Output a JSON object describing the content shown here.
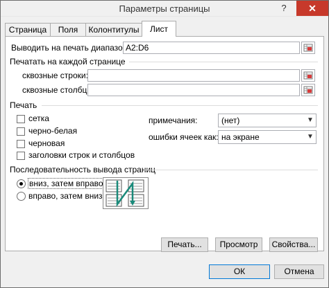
{
  "window": {
    "title": "Параметры страницы",
    "help": "?",
    "close": "✕"
  },
  "tabs": [
    "Страница",
    "Поля",
    "Колонтитулы",
    "Лист"
  ],
  "print_area": {
    "label": "Выводить на печать диапазон:",
    "value": "A2:D6"
  },
  "titles": {
    "heading": "Печатать на каждой странице",
    "rows_label": "сквозные строки:",
    "rows_value": "",
    "cols_label": "сквозные столбцы:",
    "cols_value": ""
  },
  "print": {
    "heading": "Печать",
    "checkboxes": [
      "сетка",
      "черно-белая",
      "черновая",
      "заголовки строк и столбцов"
    ],
    "comments_label": "примечания:",
    "comments_value": "(нет)",
    "errors_label": "ошибки ячеек как:",
    "errors_value": "на экране"
  },
  "order": {
    "heading": "Последовательность вывода страниц",
    "options": [
      "вниз, затем вправо",
      "вправо, затем вниз"
    ],
    "selected": "вниз, затем вправо"
  },
  "buttons": {
    "print": "Печать...",
    "preview": "Просмотр",
    "properties": "Свойства...",
    "ok": "ОК",
    "cancel": "Отмена"
  },
  "colors": {
    "close_bg": "#c7392b",
    "accent": "#0078d7",
    "preview_arrow": "#1a8a7a"
  },
  "icons": [
    "range-selector-icon",
    "checkbox-icon",
    "radio-icon",
    "dropdown-arrow-icon",
    "page-order-preview-icon"
  ]
}
